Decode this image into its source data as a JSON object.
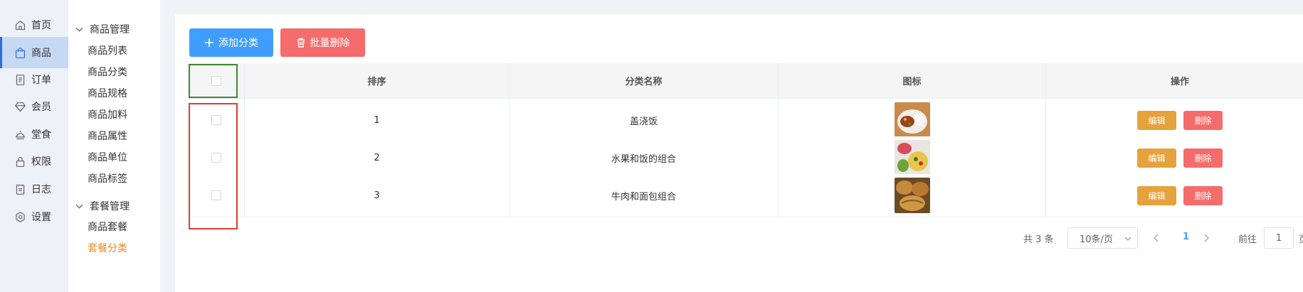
{
  "nav_primary": [
    {
      "label": "首页",
      "icon": "home-icon"
    },
    {
      "label": "商品",
      "icon": "bag-icon",
      "active": true
    },
    {
      "label": "订单",
      "icon": "order-icon"
    },
    {
      "label": "会员",
      "icon": "diamond-icon"
    },
    {
      "label": "堂食",
      "icon": "dish-icon"
    },
    {
      "label": "权限",
      "icon": "lock-icon"
    },
    {
      "label": "日志",
      "icon": "log-icon"
    },
    {
      "label": "设置",
      "icon": "gear-icon"
    }
  ],
  "nav_secondary": {
    "groups": [
      {
        "title": "商品管理",
        "items": [
          "商品列表",
          "商品分类",
          "商品规格",
          "商品加料",
          "商品属性",
          "商品单位",
          "商品标签"
        ]
      },
      {
        "title": "套餐管理",
        "items": [
          "商品套餐",
          "套餐分类"
        ]
      }
    ],
    "active_item": "套餐分类"
  },
  "toolbar": {
    "add_label": "添加分类",
    "batch_delete_label": "批量删除"
  },
  "table": {
    "columns": [
      "排序",
      "分类名称",
      "图标",
      "操作"
    ],
    "rows": [
      {
        "sort": "1",
        "name": "盖浇饭",
        "icon": "rice-dish-thumbnail"
      },
      {
        "sort": "2",
        "name": "水果和饭的组合",
        "icon": "fruit-rice-thumbnail"
      },
      {
        "sort": "3",
        "name": "牛肉和面包组合",
        "icon": "bread-thumbnail"
      }
    ],
    "edit_label": "编辑",
    "delete_label": "删除"
  },
  "pagination": {
    "total_text": "共 3 条",
    "page_size": "10条/页",
    "current_page": "1",
    "goto_prefix": "前往",
    "goto_value": "1",
    "goto_suffix": "页"
  },
  "colors": {
    "primary": "#409eff",
    "danger": "#f56c6c",
    "warning": "#e6a23c",
    "active_menu": "#f08a24",
    "highlight_green": "#3c8a2e",
    "highlight_red": "#e53935"
  }
}
